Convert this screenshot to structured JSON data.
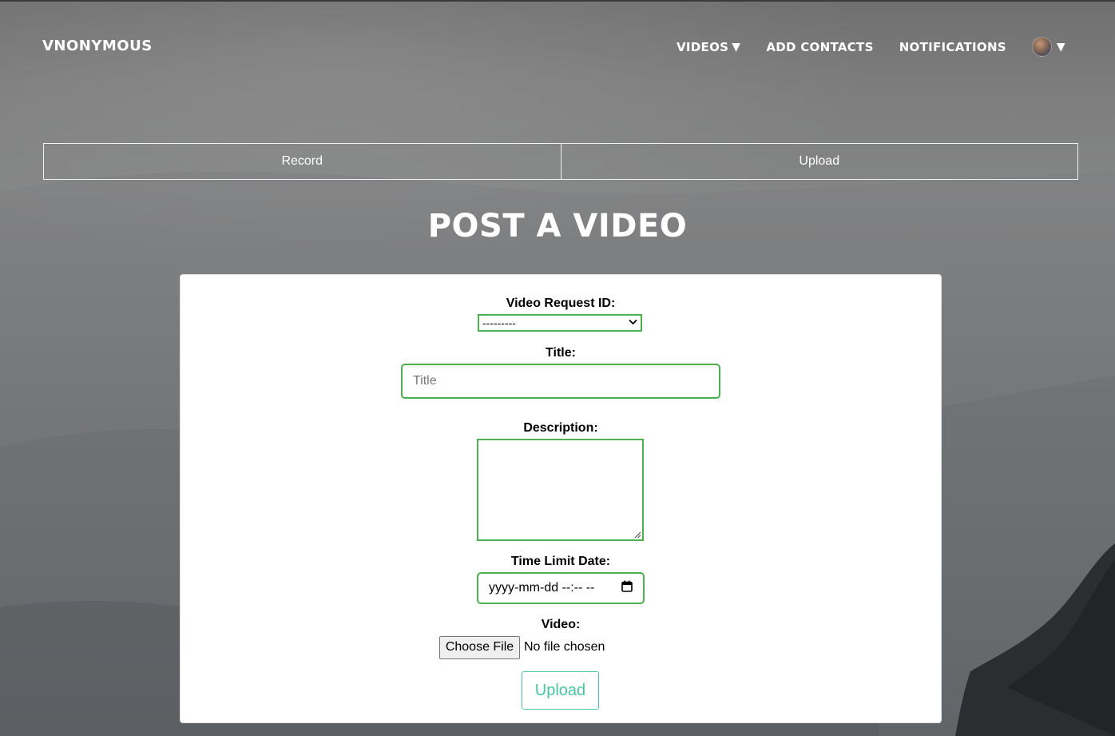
{
  "nav": {
    "brand": "VNONYMOUS",
    "items": [
      {
        "label": "VIDEOS",
        "has_caret": true
      },
      {
        "label": "ADD CONTACTS"
      },
      {
        "label": "NOTIFICATIONS"
      }
    ],
    "caret_glyph": "▼",
    "avatar_icon": "avatar-icon"
  },
  "tabs": [
    {
      "label": "Record"
    },
    {
      "label": "Upload"
    }
  ],
  "page_title": "POST A VIDEO",
  "form": {
    "request_id_label": "Video Request ID:",
    "request_id_selected": "---------",
    "title_label": "Title:",
    "title_placeholder": "Title",
    "title_value": "",
    "description_label": "Description:",
    "time_limit_label": "Time Limit Date:",
    "time_limit_placeholder": "yyyy-mm-dd --:-- --",
    "video_label": "Video:",
    "choose_file_label": "Choose File",
    "file_status": "No file chosen",
    "submit_label": "Upload"
  },
  "colors": {
    "field_border": "#4caf50",
    "submit_accent": "#46c89a"
  }
}
